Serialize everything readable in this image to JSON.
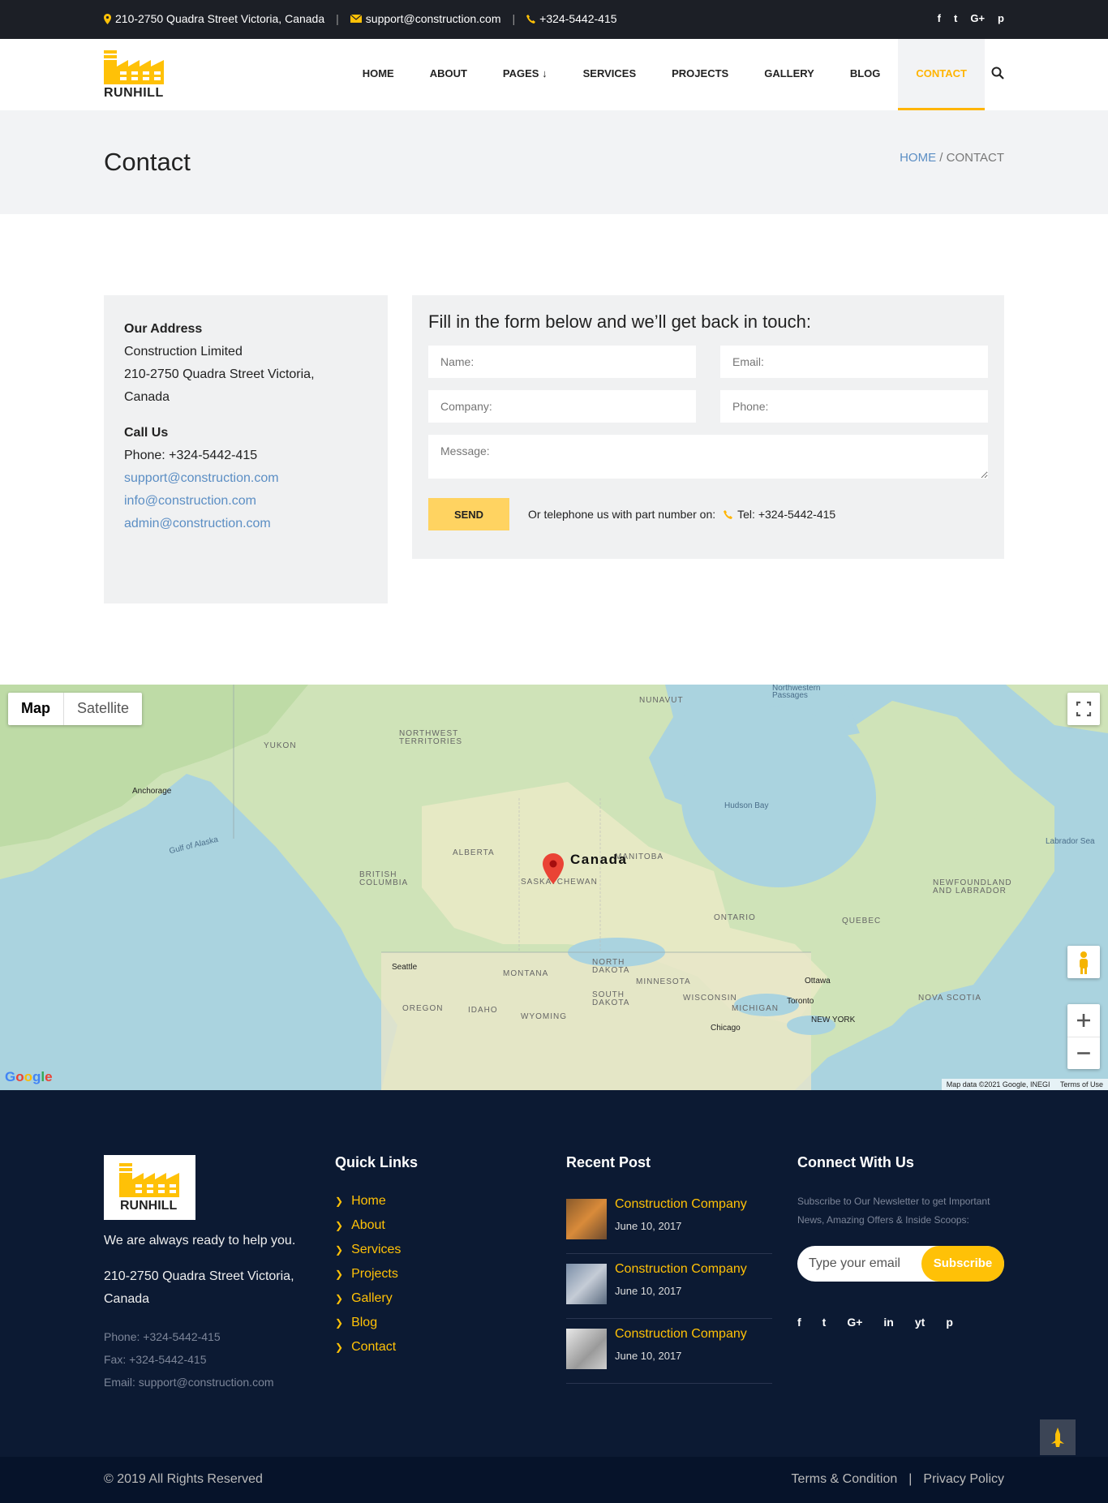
{
  "topbar": {
    "address": "210-2750 Quadra Street Victoria, Canada",
    "email": "support@construction.com",
    "phone": "+324-5442-415",
    "social": [
      "f",
      "t",
      "G+",
      "p"
    ]
  },
  "brand": {
    "name": "RUNHILL",
    "color": "#ffc107"
  },
  "nav": {
    "items": [
      "HOME",
      "ABOUT",
      "PAGES",
      "SERVICES",
      "PROJECTS",
      "GALLERY",
      "BLOG",
      "CONTACT"
    ],
    "active": "CONTACT"
  },
  "banner": {
    "title": "Contact",
    "crumb_home": "HOME",
    "crumb_sep": " / ",
    "crumb_current": "CONTACT"
  },
  "address_card": {
    "title": "Our Address",
    "lines": [
      "Construction Limited",
      "210-2750 Quadra Street Victoria,",
      "Canada"
    ],
    "call_title": "Call Us",
    "phone": "Phone: +324-5442-415",
    "emails": [
      "support@construction.com",
      "info@construction.com",
      "admin@construction.com"
    ]
  },
  "form": {
    "title": "Fill in the form below and we’ll get back in touch:",
    "name_placeholder": "Name:",
    "email_placeholder": "Email:",
    "company_placeholder": "Company:",
    "phone_placeholder": "Phone:",
    "message_placeholder": "Message:",
    "send_label": "SEND",
    "note": "Or telephone us with part number on:",
    "tel": "Tel: +324-5442-415"
  },
  "map": {
    "map_label": "Map",
    "satellite_label": "Satellite",
    "marker_label": "Canada",
    "regions": [
      "NUNAVUT",
      "NORTHWEST TERRITORIES",
      "YUKON",
      "ALBERTA",
      "BRITISH COLUMBIA",
      "SASKATCHEWAN",
      "MANITOBA",
      "ONTARIO",
      "QUEBEC",
      "NEWFOUNDLAND AND LABRADOR",
      "MONTANA",
      "NORTH DAKOTA",
      "SOUTH DAKOTA",
      "MINNESOTA",
      "WISCONSIN",
      "MICHIGAN",
      "OREGON",
      "IDAHO",
      "WYOMING",
      "NOVA SCOTIA"
    ],
    "water": [
      "Hudson Bay",
      "Gulf of Alaska",
      "Labrador Sea",
      "Northwestern Passages"
    ],
    "cities": [
      "Anchorage",
      "Seattle",
      "Ottawa",
      "Toronto",
      "Chicago",
      "NEW YORK"
    ],
    "attribution": "Map data ©2021 Google, INEGI",
    "terms": "Terms of Use",
    "google": "Google"
  },
  "footer": {
    "tagline": "We are always ready to help you.",
    "address": "210-2750 Quadra Street Victoria, Canada",
    "phone": "Phone: +324-5442-415",
    "fax": "Fax: +324-5442-415",
    "email": "Email: support@construction.com",
    "quick_title": "Quick Links",
    "quick_links": [
      "Home",
      "About",
      "Services",
      "Projects",
      "Gallery",
      "Blog",
      "Contact"
    ],
    "recent_title": "Recent Post",
    "posts": [
      {
        "title": "Construction Company",
        "date": "June 10, 2017"
      },
      {
        "title": "Construction Company",
        "date": "June 10, 2017"
      },
      {
        "title": "Construction Company",
        "date": "June 10, 2017"
      }
    ],
    "connect_title": "Connect With Us",
    "newsletter_text": "Subscribe to Our Newsletter to get Important News, Amazing Offers & Inside Scoops:",
    "email_placeholder": "Type your email",
    "subscribe_label": "Subscribe",
    "social": [
      "f",
      "t",
      "G+",
      "in",
      "yt",
      "p"
    ]
  },
  "bottom": {
    "copyright": "© 2019 All Rights Reserved",
    "terms": "Terms & Condition",
    "sep": "|",
    "privacy": "Privacy Policy"
  }
}
